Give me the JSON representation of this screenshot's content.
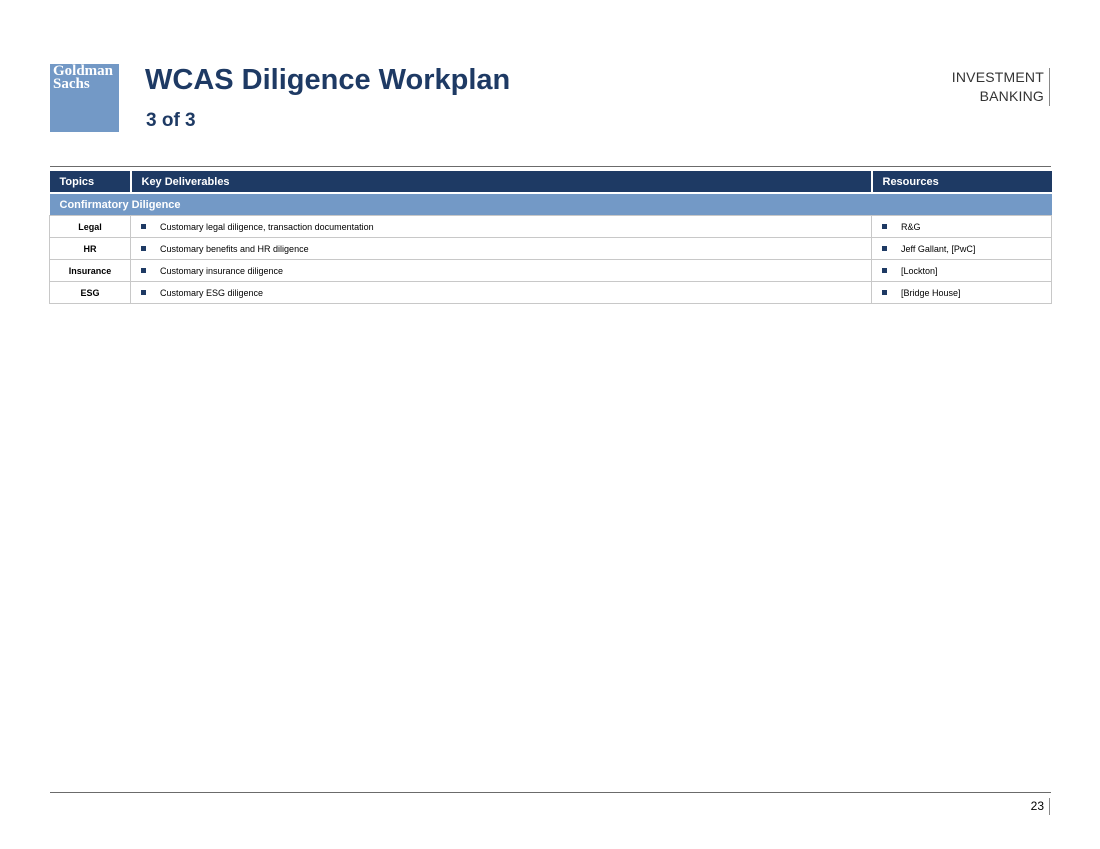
{
  "logo": {
    "line1": "Goldman",
    "line2": "Sachs"
  },
  "header": {
    "title": "WCAS Diligence Workplan",
    "subtitle": "3 of 3",
    "division_line1": "INVESTMENT",
    "division_line2": "BANKING"
  },
  "table": {
    "columns": [
      "Topics",
      "Key Deliverables",
      "Resources"
    ],
    "section": "Confirmatory Diligence",
    "rows": [
      {
        "topic": "Legal",
        "deliverable": "Customary legal diligence, transaction documentation",
        "resource": "R&G"
      },
      {
        "topic": "HR",
        "deliverable": "Customary benefits and HR diligence",
        "resource": "Jeff Gallant, [PwC]"
      },
      {
        "topic": "Insurance",
        "deliverable": "Customary insurance diligence",
        "resource": "[Lockton]"
      },
      {
        "topic": "ESG",
        "deliverable": "Customary ESG diligence",
        "resource": "[Bridge House]"
      }
    ]
  },
  "footer": {
    "page_number": "23"
  },
  "colors": {
    "navy": "#1e3a64",
    "light_blue": "#7399c6"
  },
  "icons": {
    "bullet": "square-bullet-icon"
  }
}
